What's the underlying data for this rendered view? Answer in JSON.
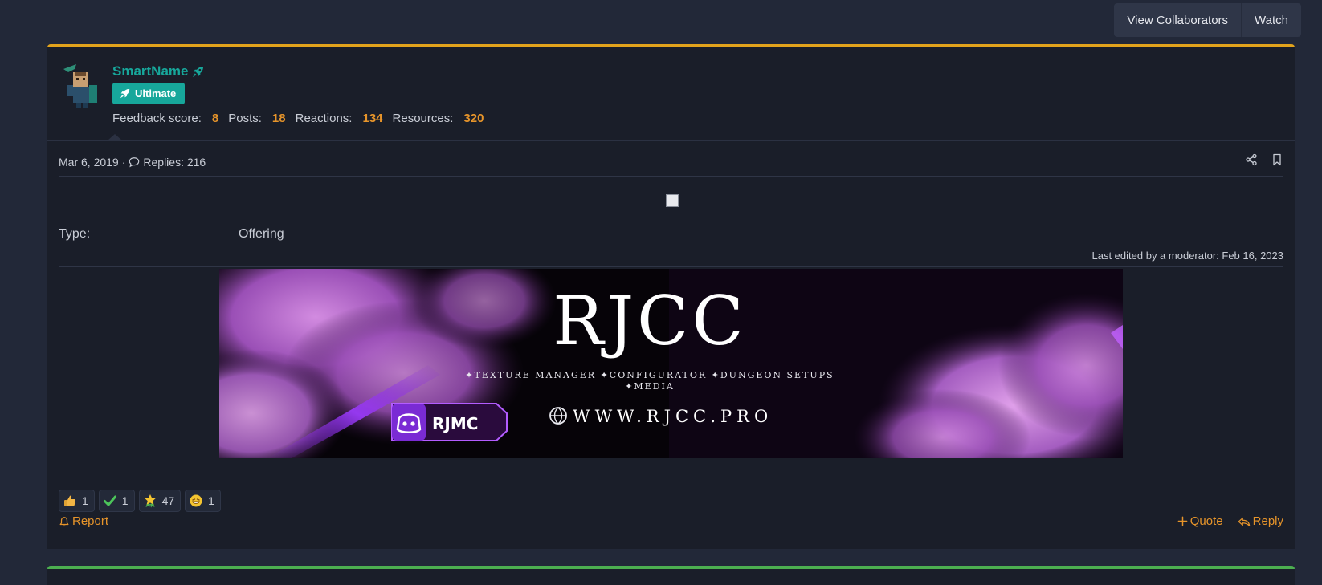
{
  "header": {
    "view_collaborators": "View Collaborators",
    "watch": "Watch"
  },
  "user": {
    "name": "SmartName",
    "badge": "Ultimate",
    "stats": [
      {
        "label": "Feedback score:",
        "value": "8"
      },
      {
        "label": "Posts:",
        "value": "18"
      },
      {
        "label": "Reactions:",
        "value": "134"
      },
      {
        "label": "Resources:",
        "value": "320"
      }
    ]
  },
  "post": {
    "date": "Mar 6, 2019",
    "separator": "·",
    "replies": "Replies: 216",
    "type_label": "Type:",
    "type_value": "Offering",
    "last_edited": "Last edited by a moderator: Feb 16, 2023"
  },
  "banner": {
    "title": "RJCC",
    "subtitle_line1": "✦TEXTURE MANAGER ✦CONFIGURATOR ✦DUNGEON SETUPS",
    "subtitle_line2": "✦MEDIA",
    "discord_label": "RJMC",
    "website": "WWW.RJCC.PRO"
  },
  "reactions": [
    {
      "icon": "thumbs-up-icon",
      "count": "1"
    },
    {
      "icon": "checkmark-icon",
      "count": "1"
    },
    {
      "icon": "star-award-icon",
      "count": "47"
    },
    {
      "icon": "grin-face-icon",
      "count": "1"
    }
  ],
  "actions": {
    "report": "Report",
    "quote": "Quote",
    "reply": "Reply"
  },
  "colors": {
    "accent_orange": "#e6942a",
    "teal": "#17a79b",
    "post_border_top": "#e2a31c",
    "next_post_border": "#4caf50"
  }
}
